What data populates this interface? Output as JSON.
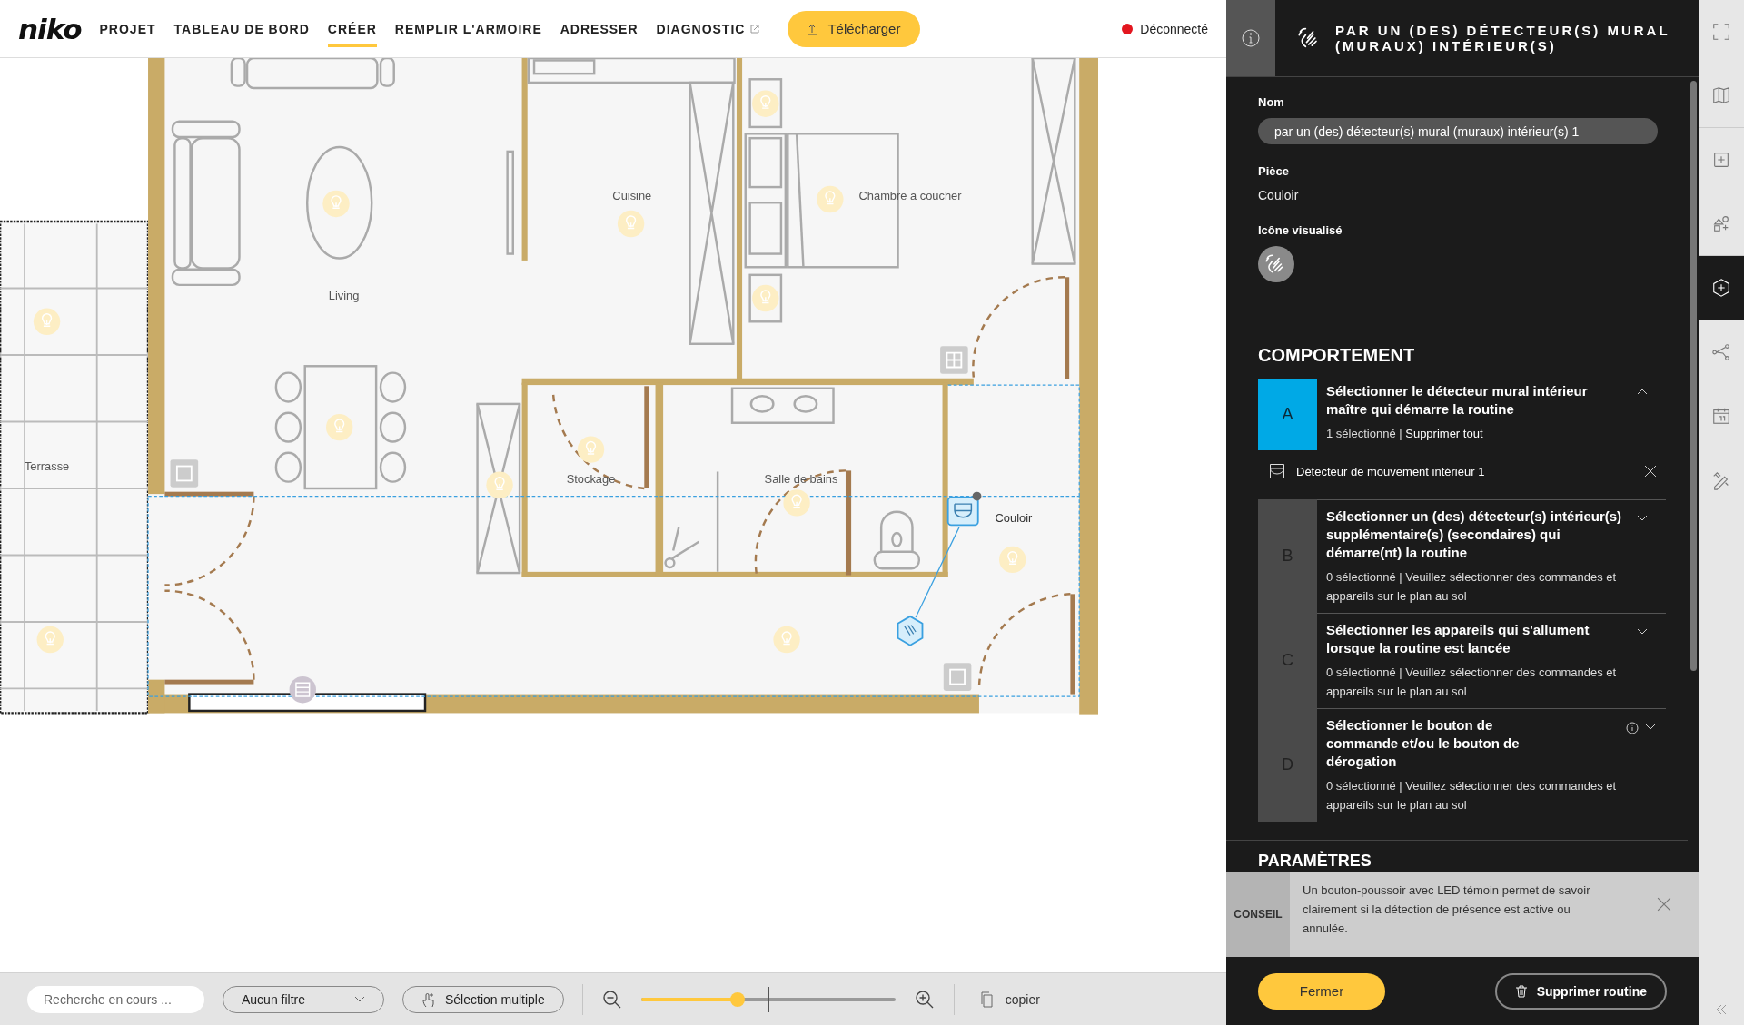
{
  "nav": {
    "logo": "niko",
    "items": [
      {
        "label": "PROJET",
        "selected": false,
        "external": false
      },
      {
        "label": "TABLEAU DE BORD",
        "selected": false,
        "external": false
      },
      {
        "label": "CRÉER",
        "selected": true,
        "external": false
      },
      {
        "label": "REMPLIR L'ARMOIRE",
        "selected": false,
        "external": false
      },
      {
        "label": "ADRESSER",
        "selected": false,
        "external": false
      },
      {
        "label": "DIAGNOSTIC",
        "selected": false,
        "external": true
      }
    ],
    "upload_button": "Télécharger",
    "status": {
      "label": "Déconnecté",
      "connected": false
    }
  },
  "floor_plan": {
    "rooms": [
      {
        "name": "Living"
      },
      {
        "name": "Cuisine"
      },
      {
        "name": "Chambre a coucher"
      },
      {
        "name": "Terrasse"
      },
      {
        "name": "Stockage"
      },
      {
        "name": "Salle de bains"
      },
      {
        "name": "Couloir",
        "selected": true
      }
    ]
  },
  "bottom_bar": {
    "search": {
      "placeholder": "Recherche en cours ..."
    },
    "filter": "Aucun filtre",
    "multi_select": "Sélection multiple",
    "zoom": {
      "level": 0.38
    },
    "copy": "copier"
  },
  "panel": {
    "title": "PAR UN (DES) DÉTECTEUR(S) MURAL (MURAUX) INTÉRIEUR(S)",
    "fields": [
      {
        "kind": "input",
        "label": "Nom",
        "value": "par un (des) détecteur(s) mural (muraux) intérieur(s) 1"
      },
      {
        "kind": "text",
        "label": "Pièce",
        "value": "Couloir"
      },
      {
        "kind": "icon",
        "label": "Icône visualisé"
      }
    ],
    "behaviour_heading": "COMPORTEMENT",
    "steps": [
      {
        "letter": "A",
        "title": "Sélectionner le détecteur mural intérieur maître qui démarre la routine",
        "status": "1 sélectionné |",
        "action": "Supprimer tout",
        "selected": true,
        "expanded": true,
        "info": false,
        "items": [
          {
            "label": "Détecteur de mouvement intérieur 1"
          }
        ]
      },
      {
        "letter": "B",
        "title": "Sélectionner un (des) détecteur(s) intérieur(s) supplémentaire(s) (secondaires) qui démarre(nt) la routine",
        "status": "0 sélectionné | Veuillez sélectionner des commandes et appareils sur le plan au sol",
        "selected": false,
        "expanded": false,
        "info": false
      },
      {
        "letter": "C",
        "title": "Sélectionner les appareils qui s'allument lorsque la routine est lancée",
        "status": "0 sélectionné | Veuillez sélectionner des commandes et appareils sur le plan au sol",
        "selected": false,
        "expanded": false,
        "info": false
      },
      {
        "letter": "D",
        "title": "Sélectionner le bouton de commande et/ou le bouton de dérogation",
        "status": "0 sélectionné | Veuillez sélectionner des commandes et appareils sur le plan au sol",
        "selected": false,
        "expanded": false,
        "info": true
      }
    ],
    "parameters_heading": "PARAMÈTRES",
    "tip": {
      "label": "CONSEIL",
      "text": "Un bouton-poussoir avec LED témoin permet de savoir clairement si la détection de présence est active ou annulée."
    },
    "close_button": "Fermer",
    "delete_button": "Supprimer routine"
  },
  "tool_rail": [
    {
      "kind": "fullscreen",
      "selected": false
    },
    {
      "kind": "map",
      "selected": false
    },
    {
      "kind": "add-room",
      "selected": false
    },
    {
      "kind": "add-shape",
      "selected": false
    },
    {
      "kind": "add-device",
      "selected": true
    },
    {
      "kind": "connections",
      "selected": false
    },
    {
      "kind": "calendar",
      "selected": false
    },
    {
      "kind": "tools",
      "selected": false
    }
  ]
}
